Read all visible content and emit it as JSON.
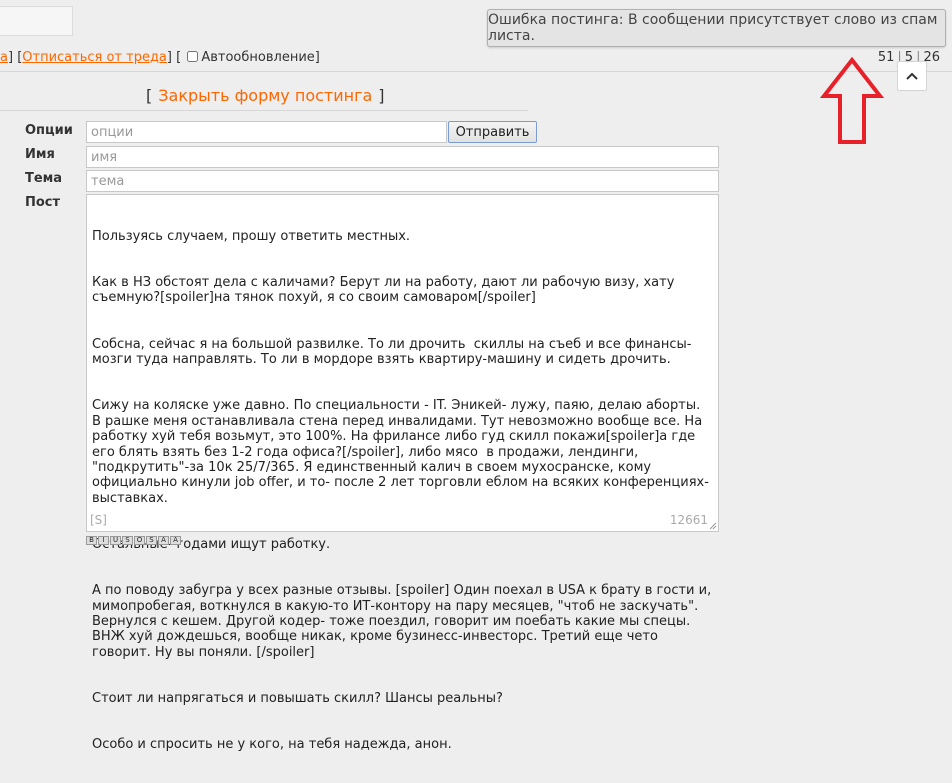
{
  "thread_bar": {
    "link_partial": "а",
    "unsubscribe_label": "Отписаться от треда",
    "autoupdate_label": "Автообновление"
  },
  "counts": {
    "posts": "51",
    "files": "5",
    "unique": "26"
  },
  "toast": {
    "message": "Ошибка постинга: В сообщении присутствует слово из спам листа."
  },
  "form": {
    "close_label": "Закрыть форму постинга",
    "options_label": "Опции",
    "options_placeholder": "опции",
    "send_label": "Отправить",
    "name_label": "Имя",
    "name_placeholder": "имя",
    "subject_label": "Тема",
    "subject_placeholder": "тема",
    "post_label": "Пост",
    "post_lines": [
      "Пользуясь случаем, прошу ответить местных.",
      "Как в НЗ обстоят дела с каличами? Берут ли на работу, дают ли рабочую визу, хату съемную?[spoiler]на тянок похуй, я со своим самоваром[/spoiler]",
      "Собсна, сейчас я на большой развилке. То ли дрочить  скиллы на съеб и все финансы-мозги туда направлять. То ли в мордоре взять квартиру-машину и сидеть дрочить.",
      "Сижу на коляске уже давно. По специальности - IT. Эникей- лужу, паяю, делаю аборты. В рашке меня останавливала стена перед инвалидами. Тут невозможно вообще все. На работку хуй тебя возьмут, это 100%. На фрилансе либо гуд скилл покажи[spoiler]а где его блять взять без 1-2 года офиса?[/spoiler], либо мясо  в продажи, лендинги, \"подкрутить\"-за 10к 25/7/365. Я единственный калич в своем мухосранске, кому официально кинули job offer, и то- после 2 лет торговли еблом на всяких конференциях-выставках.",
      "Остальные- годами ищут работку.",
      "А по поводу забугра у всех разные отзывы. [spoiler] Один поехал в USA к брату в гости и, мимопробегая, воткнулся в какую-то ИТ-контору на пару месяцев, \"чтоб не заскучать\". Вернулся с кешем. Другой кодер- тоже поездил, говорит им поебать какие мы спецы. ВНЖ хуй дождешься, вообще никак, кроме бузинесс-инвесторс. Третий еще чето говорит. Ну вы поняли. [/spoiler]",
      "Стоит ли напрягаться и повышать скилл? Шансы реальны?",
      "Особо и спросить не у кого, на тебя надежда, анон."
    ],
    "spoiler_tag": "[S]",
    "char_count": "12661"
  },
  "toolbar": {
    "buttons": [
      "B",
      "I",
      "U",
      "S",
      "O",
      "S",
      "A",
      "A"
    ]
  },
  "colors": {
    "accent": "#ff6600",
    "arrow": "#e8202a",
    "error_underline": "#e00000"
  }
}
